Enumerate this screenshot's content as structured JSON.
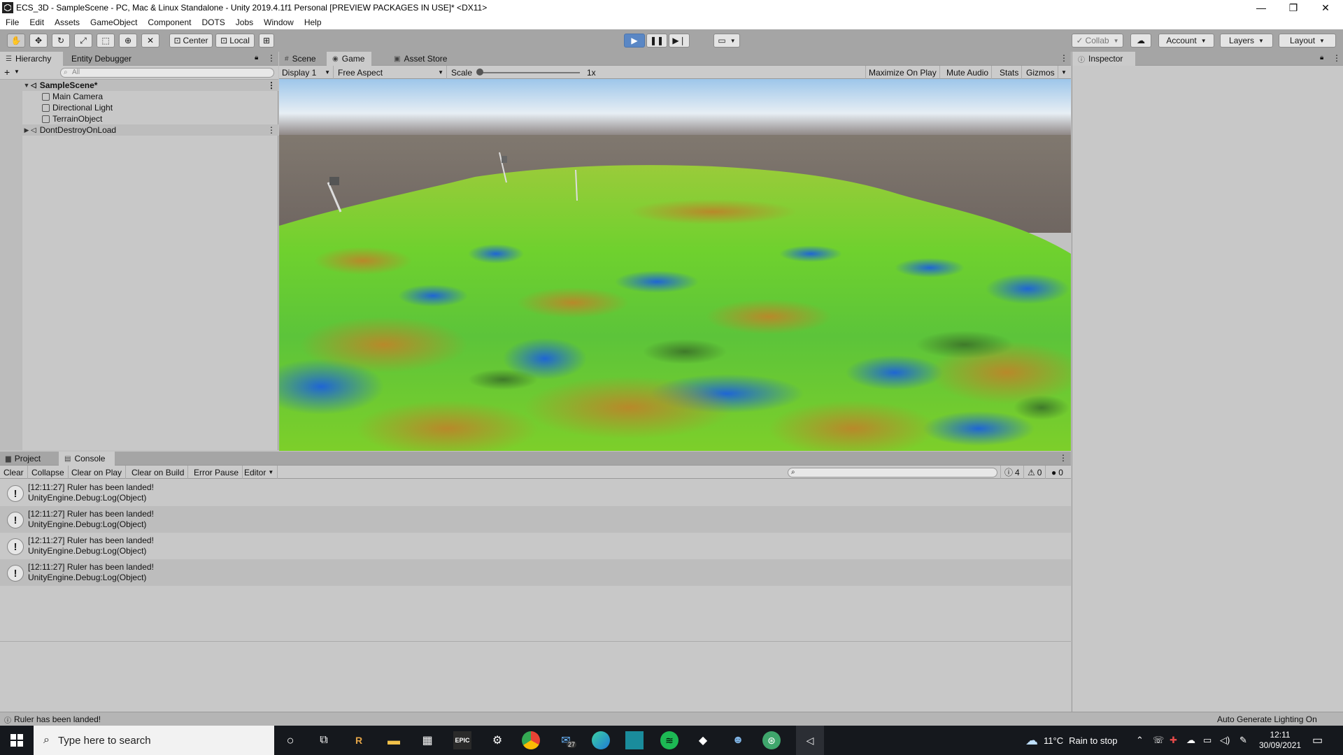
{
  "window": {
    "title": "ECS_3D - SampleScene - PC, Mac & Linux Standalone - Unity 2019.4.1f1 Personal [PREVIEW PACKAGES IN USE]* <DX11>",
    "minimize": "—",
    "maximize": "❐",
    "close": "✕"
  },
  "menu": [
    "File",
    "Edit",
    "Assets",
    "GameObject",
    "Component",
    "DOTS",
    "Jobs",
    "Window",
    "Help"
  ],
  "toolbar": {
    "pivot_label": "Center",
    "space_label": "Local",
    "collab_label": "Collab",
    "account_label": "Account",
    "layers_label": "Layers",
    "layout_label": "Layout"
  },
  "hierarchy": {
    "tabs": [
      "Hierarchy",
      "Entity Debugger"
    ],
    "search_placeholder": "All",
    "add": "+",
    "scene": "SampleScene*",
    "children": [
      "Main Camera",
      "Directional Light",
      "TerrainObject"
    ],
    "ddol": "DontDestroyOnLoad"
  },
  "center": {
    "tabs": [
      "Scene",
      "Game",
      "Asset Store"
    ],
    "display": "Display 1",
    "aspect": "Free Aspect",
    "scale_label": "Scale",
    "scale_value": "1x",
    "scale_level": 0.02,
    "toggles": [
      "Maximize On Play",
      "Mute Audio",
      "Stats",
      "Gizmos"
    ]
  },
  "inspector": {
    "tab": "Inspector"
  },
  "console": {
    "tabs": [
      "Project",
      "Console"
    ],
    "buttons": [
      "Clear",
      "Collapse",
      "Clear on Play",
      "Clear on Build",
      "Error Pause",
      "Editor"
    ],
    "counts": {
      "info": "4",
      "warn": "0",
      "error": "0"
    },
    "logs": [
      {
        "msg": "[12:11:27] Ruler has been landed!",
        "trace": "UnityEngine.Debug:Log(Object)"
      },
      {
        "msg": "[12:11:27] Ruler has been landed!",
        "trace": "UnityEngine.Debug:Log(Object)"
      },
      {
        "msg": "[12:11:27] Ruler has been landed!",
        "trace": "UnityEngine.Debug:Log(Object)"
      },
      {
        "msg": "[12:11:27] Ruler has been landed!",
        "trace": "UnityEngine.Debug:Log(Object)"
      }
    ]
  },
  "status": {
    "message": "Ruler has been landed!",
    "lighting": "Auto Generate Lighting On"
  },
  "taskbar": {
    "search_placeholder": "Type here to search",
    "mail_badge": "27",
    "weather_temp": "11°C",
    "weather_text": "Rain to stop",
    "time": "12:11",
    "date": "30/09/2021"
  },
  "colors": {
    "play_active": "#5a87c5",
    "terrain_green": "#6fd12e",
    "terrain_blue": "#1f66d4",
    "terrain_brown": "#b8892a",
    "taskbar": "#15181d"
  }
}
